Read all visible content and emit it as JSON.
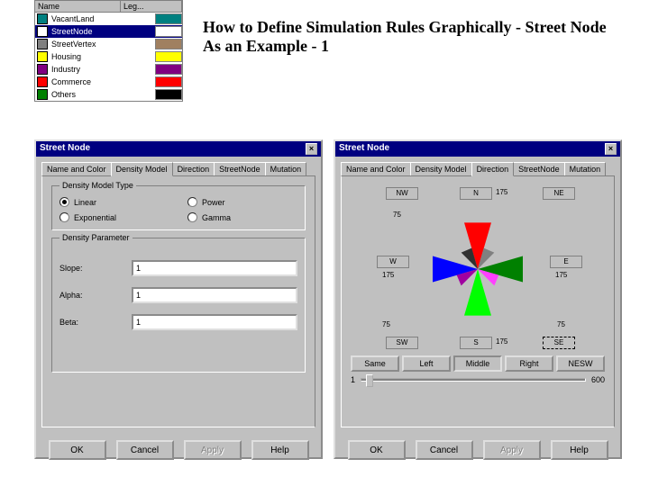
{
  "title": "How to Define Simulation Rules Graphically - Street Node As an Example - 1",
  "legend": {
    "headers": [
      "Name",
      "Leg..."
    ],
    "rows": [
      {
        "name": "VacantLand",
        "iconColor": "#008080",
        "swatch": "#008080",
        "selected": false
      },
      {
        "name": "StreetNode",
        "iconColor": "#ffffff",
        "swatch": "#ffffff",
        "selected": true
      },
      {
        "name": "StreetVertex",
        "iconColor": "#808080",
        "swatch": "#a08060",
        "selected": false
      },
      {
        "name": "Housing",
        "iconColor": "#ffff00",
        "swatch": "#ffff00",
        "selected": false
      },
      {
        "name": "Industry",
        "iconColor": "#800080",
        "swatch": "#800080",
        "selected": false
      },
      {
        "name": "Commerce",
        "iconColor": "#ff0000",
        "swatch": "#ff0000",
        "selected": false
      },
      {
        "name": "Others",
        "iconColor": "#008000",
        "swatch": "#000000",
        "selected": false
      }
    ]
  },
  "dlgLeft": {
    "title": "Street Node",
    "tabs": [
      "Name and Color",
      "Density Model",
      "Direction",
      "StreetNode",
      "Mutation"
    ],
    "activeTab": 1,
    "group1": {
      "title": "Density Model Type",
      "radios": [
        {
          "label": "Linear",
          "checked": true
        },
        {
          "label": "Power",
          "checked": false
        },
        {
          "label": "Exponential",
          "checked": false
        },
        {
          "label": "Gamma",
          "checked": false
        }
      ]
    },
    "group2": {
      "title": "Density Parameter",
      "params": [
        {
          "label": "Slope:",
          "value": "1"
        },
        {
          "label": "Alpha:",
          "value": "1"
        },
        {
          "label": "Beta:",
          "value": "1"
        }
      ]
    },
    "buttons": [
      "OK",
      "Cancel",
      "Apply",
      "Help"
    ]
  },
  "dlgRight": {
    "title": "Street Node",
    "tabs": [
      "Name and Color",
      "Density Model",
      "Direction",
      "StreetNode",
      "Mutation"
    ],
    "activeTab": 2,
    "directions": {
      "NW": {
        "label": "NW",
        "val": ""
      },
      "N": {
        "label": "N",
        "val": "175"
      },
      "NE": {
        "label": "NE",
        "val": ""
      },
      "W": {
        "label": "W",
        "val": "175"
      },
      "E": {
        "label": "E",
        "val": "175"
      },
      "SW": {
        "label": "SW",
        "val": ""
      },
      "S": {
        "label": "S",
        "val": "175"
      },
      "SE": {
        "label": "SE",
        "val": ""
      },
      "leftVal75": "75",
      "rightVal75": "75",
      "blVal75": "75"
    },
    "wedgeColors": {
      "N": "#ff0000",
      "E": "#008000",
      "S": "#00ff00",
      "W": "#0000ff",
      "NE": "#808080",
      "NW": "#000000",
      "SE": "#ff00ff",
      "SW": "#800080"
    },
    "alignBtns": [
      "Same",
      "Left",
      "Middle",
      "Right",
      "NESW"
    ],
    "alignActive": 2,
    "sliderMin": "1",
    "sliderMax": "600",
    "buttons": [
      "OK",
      "Cancel",
      "Apply",
      "Help"
    ]
  }
}
